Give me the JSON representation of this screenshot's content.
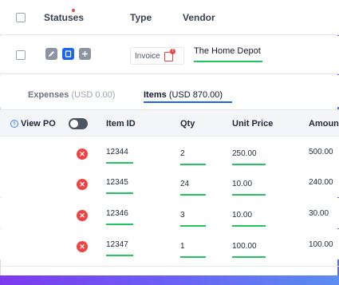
{
  "header": {
    "statuses_label": "Statuses",
    "type_label": "Type",
    "vendor_label": "Vendor"
  },
  "row": {
    "status_icons": [
      "edit-icon",
      "document-icon",
      "add-icon"
    ],
    "type_chip": "Invoice",
    "type_chip_icon": "pdf-icon",
    "vendor": "The Home Depot"
  },
  "tabs": {
    "expenses_label": "Expenses",
    "expenses_amount": "(USD 0.00)",
    "items_label": "Items",
    "items_amount": "(USD 870.00)",
    "active": "items"
  },
  "columns": {
    "view_po": "View PO",
    "view_po_toggle_on": false,
    "item_id": "Item ID",
    "qty": "Qty",
    "unit_price": "Unit Price",
    "amount": "Amoun"
  },
  "items": [
    {
      "item_id": "12344",
      "qty": "2",
      "unit_price": "250.00",
      "amount": "500.00"
    },
    {
      "item_id": "12345",
      "qty": "24",
      "unit_price": "10.00",
      "amount": "240.00"
    },
    {
      "item_id": "12346",
      "qty": "3",
      "unit_price": "10.00",
      "amount": "30.00"
    },
    {
      "item_id": "12347",
      "qty": "1",
      "unit_price": "100.00",
      "amount": "100.00"
    }
  ],
  "colors": {
    "accent": "#1c64f2",
    "valid_underline": "#22c55e",
    "remove": "#ef4444"
  }
}
